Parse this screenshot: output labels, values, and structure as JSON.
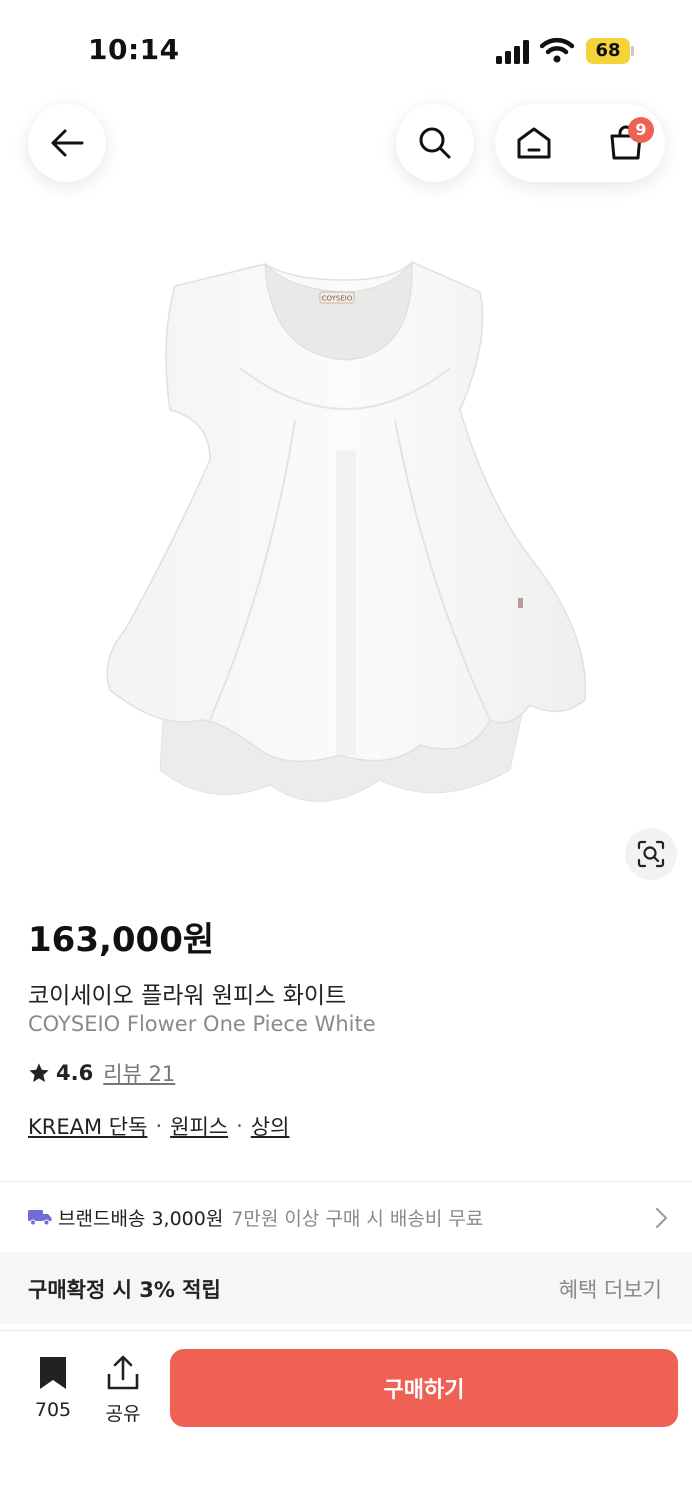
{
  "status": {
    "time": "10:14",
    "battery": "68"
  },
  "header": {
    "cart_count": "9"
  },
  "product": {
    "price": "163,000원",
    "name_ko": "코이세이오 플라워 원피스 화이트",
    "name_en": "COYSEIO Flower One Piece White",
    "rating": "4.6",
    "review_label": "리뷰 21",
    "tags": [
      "KREAM 단독",
      "원피스",
      "상의"
    ],
    "tag_separator": "·",
    "label_text": "COYSEIO"
  },
  "shipping": {
    "label": "브랜드배송 3,000원",
    "desc": "7만원 이상 구매 시 배송비 무료"
  },
  "benefit": {
    "title": "구매확정 시 3% 적립",
    "more": "혜택 더보기"
  },
  "bottom": {
    "bookmark_count": "705",
    "share_label": "공유",
    "buy_label": "구매하기"
  },
  "colors": {
    "accent": "#ef6253",
    "battery": "#f4d33b"
  },
  "icons": [
    "back-arrow-icon",
    "search-icon",
    "home-icon",
    "shopping-bag-icon",
    "lens-search-icon",
    "star-icon",
    "truck-icon",
    "chevron-right-icon",
    "bookmark-icon",
    "share-icon"
  ]
}
